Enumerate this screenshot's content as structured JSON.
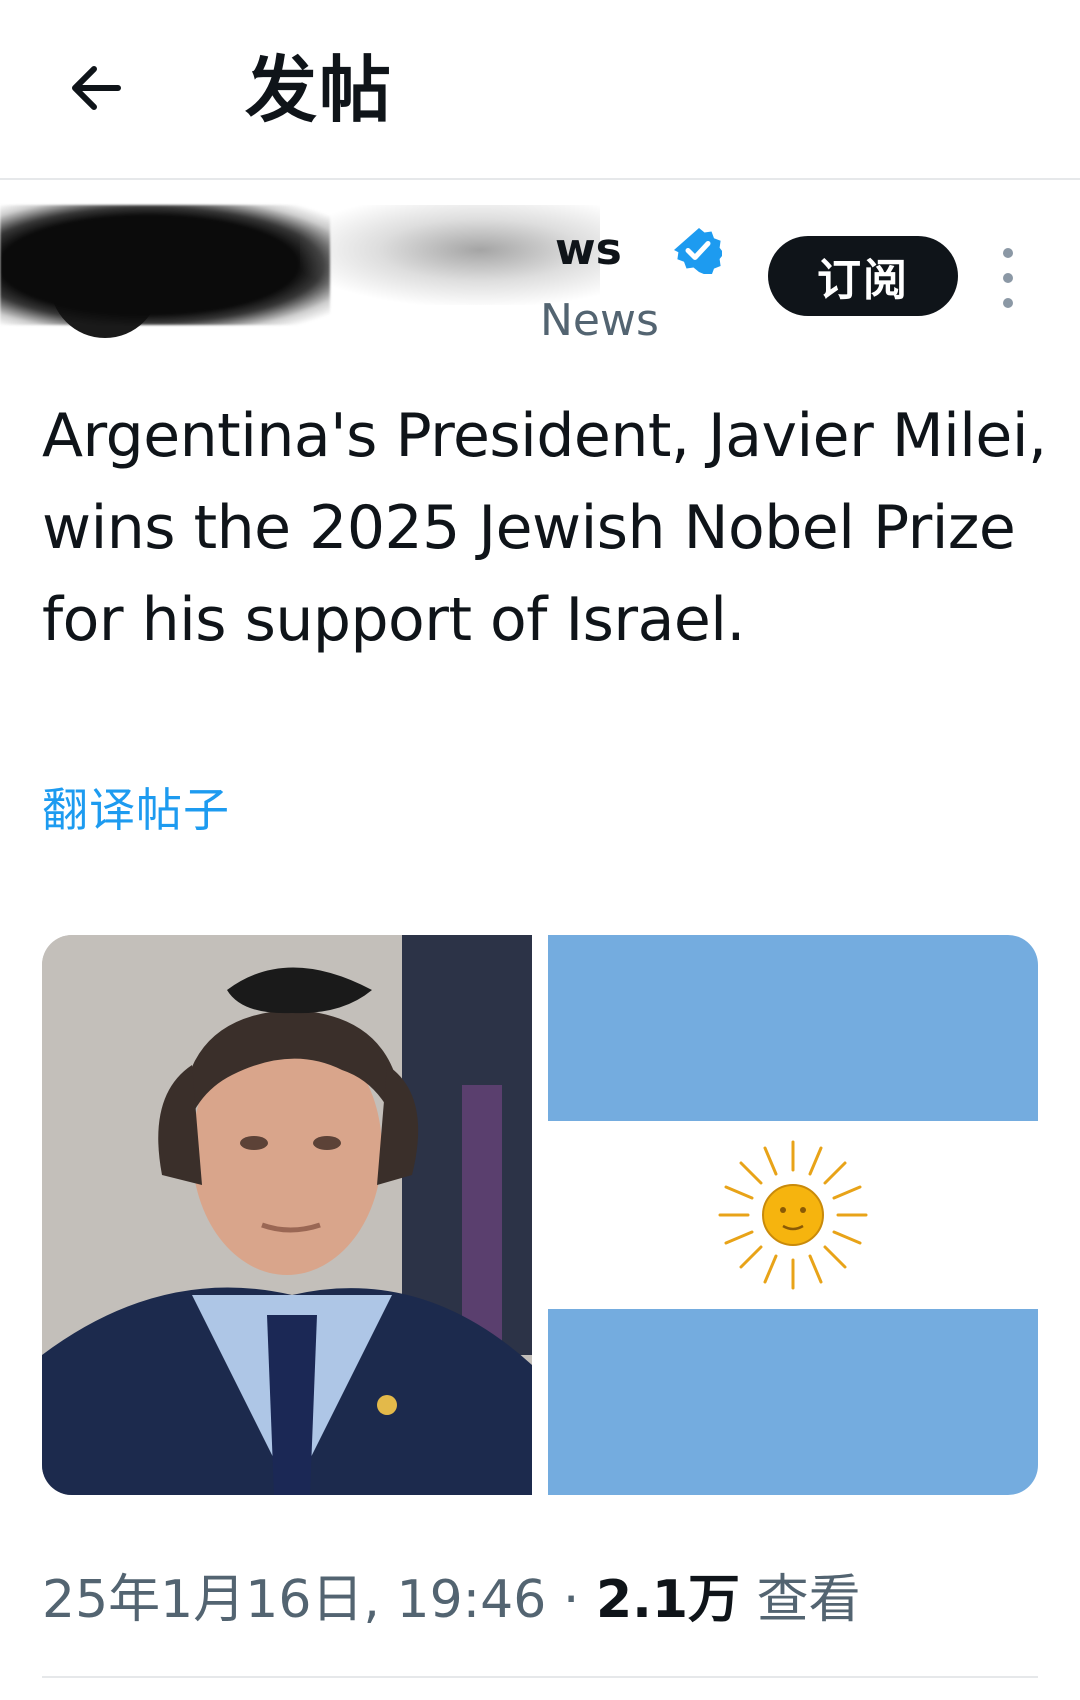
{
  "header": {
    "back_icon": "arrow-left-icon",
    "title": "发帖"
  },
  "author": {
    "display_name_visible": "ws",
    "handle_visible": "News",
    "verified": true,
    "verified_icon": "verified-badge-icon",
    "verified_color": "#1d9bf0",
    "subscribe_label": "订阅",
    "more_icon": "more-vertical-icon"
  },
  "tweet": {
    "text": "Argentina's President, Javier Milei, wins the 2025 Jewish Nobel Prize for his support of Israel.",
    "translate_label": "翻译帖子"
  },
  "media": {
    "photo_subject": "portrait-photo",
    "flag": {
      "name": "argentina-flag",
      "band_color": "#74acdf",
      "center_color": "#ffffff",
      "sun_color": "#f6b40e"
    }
  },
  "meta": {
    "date_time": "25年1月16日, 19:46",
    "separator": "·",
    "views_count": "2.1万",
    "views_label": "查看"
  },
  "colors": {
    "text": "#0f1419",
    "secondary": "#536471",
    "link": "#1d9bf0",
    "divider": "#e6e8ea"
  }
}
